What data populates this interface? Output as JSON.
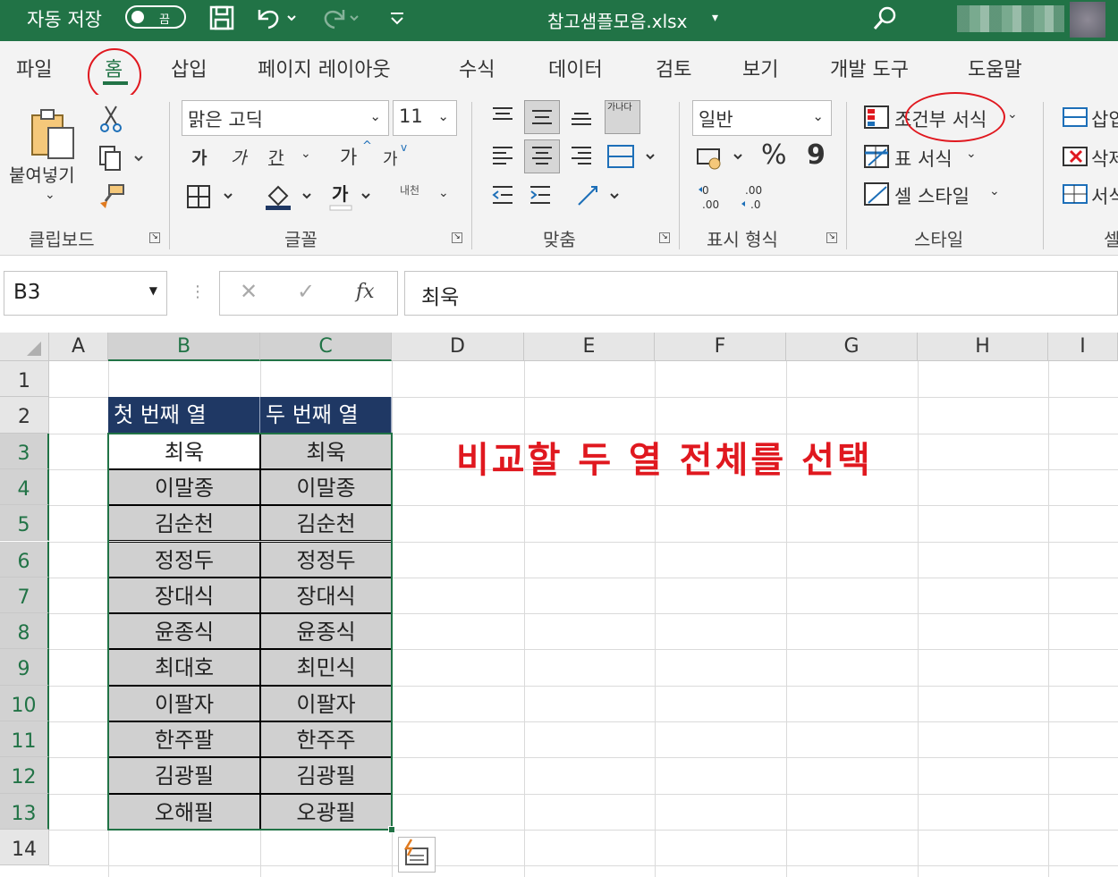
{
  "titlebar": {
    "autosave_label": "자동 저장",
    "autosave_state": "끔",
    "filename": "참고샘플모음.xlsx",
    "filename_arrow": "▾"
  },
  "tabs": [
    "파일",
    "홈",
    "삽입",
    "페이지 레이아웃",
    "수식",
    "데이터",
    "검토",
    "보기",
    "개발 도구",
    "도움말"
  ],
  "ribbon": {
    "paste_label": "붙여넣기",
    "font_name": "맑은 고딕",
    "font_size": "11",
    "bold": "가",
    "italic": "가",
    "underline": "간",
    "grow": "가",
    "shrink": "가",
    "phonetic": "내천",
    "wrap": "가나다",
    "number_format": "일반",
    "percent": "%",
    "comma": "9",
    "conditional_format": "조건부 서식",
    "table_format": "표 서식",
    "cell_style": "셀 스타일",
    "insert": "삽입",
    "delete": "삭제",
    "format": "서식",
    "groups": {
      "clipboard": "클립보드",
      "font": "글꼴",
      "alignment": "맞춤",
      "number": "표시 형식",
      "styles": "스타일",
      "cells": "셀"
    }
  },
  "formula_bar": {
    "name_box": "B3",
    "formula": "최욱",
    "fx": "fx"
  },
  "sheet": {
    "columns": [
      "A",
      "B",
      "C",
      "D",
      "E",
      "F",
      "G",
      "H",
      "I"
    ],
    "rows": [
      "1",
      "2",
      "3",
      "4",
      "5",
      "6",
      "7",
      "8",
      "9",
      "10",
      "11",
      "12",
      "13",
      "14"
    ],
    "headers": [
      "첫 번째 열",
      "두 번째 열"
    ],
    "col_b": [
      "최욱",
      "이말종",
      "김순천",
      "정정두",
      "장대식",
      "윤종식",
      "최대호",
      "이팔자",
      "한주팔",
      "김광필",
      "오해필"
    ],
    "col_c": [
      "최욱",
      "이말종",
      "김순천",
      "정정두",
      "장대식",
      "윤종식",
      "최민식",
      "이팔자",
      "한주주",
      "김광필",
      "오광필"
    ],
    "annotation": "비교할 두 열 전체를 선택"
  },
  "colors": {
    "excel_green": "#217346",
    "header_navy": "#1f3864",
    "selection_gray": "#d0d0d0",
    "annotation_red": "#e0181f"
  }
}
